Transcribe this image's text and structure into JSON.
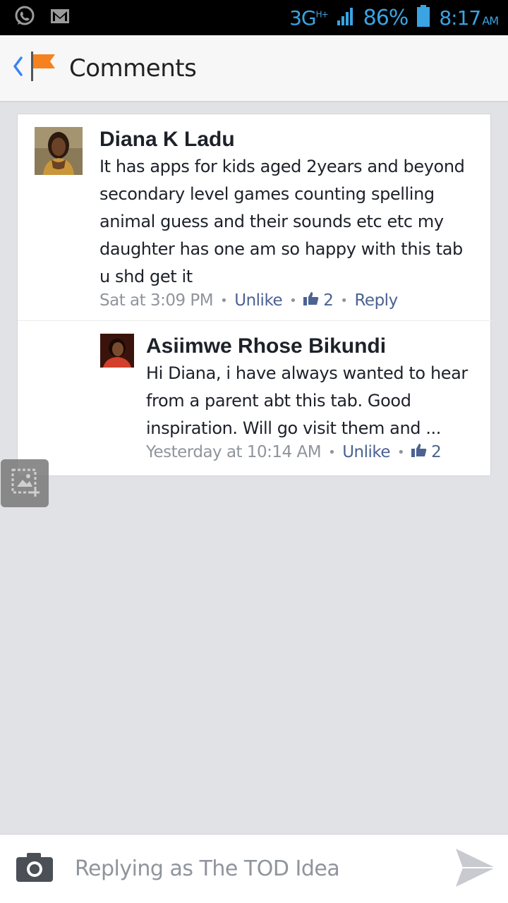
{
  "status_bar": {
    "network": "3G",
    "network_sup": "H+",
    "battery": "86%",
    "time": "8:17",
    "ampm": "AM"
  },
  "header": {
    "title": "Comments"
  },
  "comments": [
    {
      "author": "Diana K Ladu",
      "text": "It has apps for kids aged 2years and beyond secondary level games counting spelling animal guess and their sounds etc etc my daughter has one am so happy with this tab u shd get it",
      "time": "Sat at 3:09 PM",
      "unlike_label": "Unlike",
      "likes": "2",
      "reply_label": "Reply"
    },
    {
      "author": "Asiimwe Rhose Bikundi",
      "text": "Hi Diana, i have always wanted to hear from a parent abt this tab. Good inspiration. Will go visit them and ...",
      "time": "Yesterday at 10:14 AM",
      "unlike_label": "Unlike",
      "likes": "2"
    }
  ],
  "composer": {
    "placeholder": "Replying as The TOD Idea"
  },
  "colors": {
    "accent": "#3b82f6",
    "link": "#4b6293",
    "meta": "#90949c",
    "flag": "#f5821f",
    "status_icons": "#3aa3e3"
  },
  "icons": {
    "whatsapp": "whatsapp-icon",
    "gmail": "gmail-icon",
    "signal": "signal-icon",
    "battery": "battery-icon",
    "back": "chevron-left-icon",
    "flag": "flag-icon",
    "like": "thumbs-up-icon",
    "camera": "camera-icon",
    "send": "send-icon",
    "screenshot": "screenshot-icon"
  }
}
